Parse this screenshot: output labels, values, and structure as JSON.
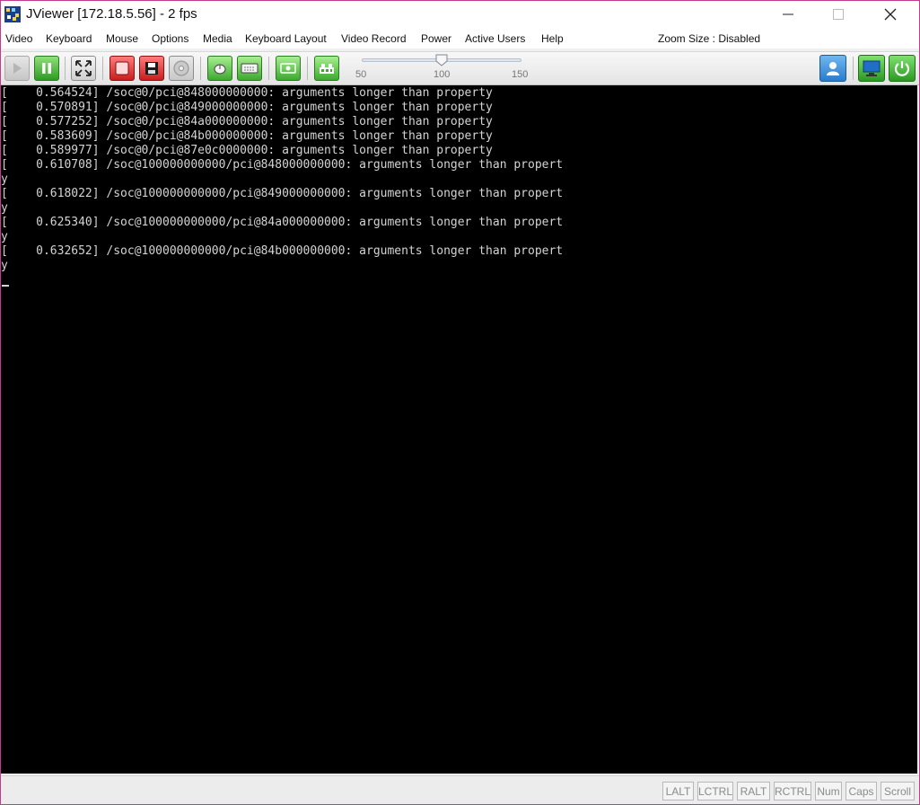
{
  "window": {
    "title": "JViewer [172.18.5.56] - 2 fps"
  },
  "menu": {
    "items": [
      "Video",
      "Keyboard",
      "Mouse",
      "Options",
      "Media",
      "Keyboard Layout",
      "Video Record",
      "Power",
      "Active Users",
      "Help"
    ],
    "zoom_label": "Zoom Size : Disabled"
  },
  "toolbar": {
    "buttons": [
      {
        "name": "play-button",
        "icon": "play-icon"
      },
      {
        "name": "pause-button",
        "icon": "pause-icon"
      },
      {
        "name": "fullscreen-button",
        "icon": "expand-icon"
      },
      {
        "name": "power-off-video-button",
        "icon": "red-screen-icon"
      },
      {
        "name": "floppy-button",
        "icon": "floppy-icon"
      },
      {
        "name": "cdrom-button",
        "icon": "cd-icon"
      },
      {
        "name": "mouse-button",
        "icon": "mouse-icon"
      },
      {
        "name": "keyboard-button",
        "icon": "keyboard-icon"
      },
      {
        "name": "video-record-button",
        "icon": "video-record-icon"
      },
      {
        "name": "soft-keyboard-button",
        "icon": "hardware-icon"
      }
    ],
    "zoom": {
      "min": "50",
      "mid": "100",
      "max": "150",
      "value": 100
    },
    "right_buttons": [
      {
        "name": "active-users-button",
        "icon": "user-icon"
      },
      {
        "name": "host-display-button",
        "icon": "monitor-icon"
      },
      {
        "name": "power-button",
        "icon": "power-icon"
      }
    ]
  },
  "console": {
    "lines": [
      "[    0.564524] /soc@0/pci@848000000000: arguments longer than property",
      "[    0.570891] /soc@0/pci@849000000000: arguments longer than property",
      "[    0.577252] /soc@0/pci@84a000000000: arguments longer than property",
      "[    0.583609] /soc@0/pci@84b000000000: arguments longer than property",
      "[    0.589977] /soc@0/pci@87e0c0000000: arguments longer than property",
      "[    0.610708] /soc@100000000000/pci@848000000000: arguments longer than propert",
      "y",
      "[    0.618022] /soc@100000000000/pci@849000000000: arguments longer than propert",
      "y",
      "[    0.625340] /soc@100000000000/pci@84a000000000: arguments longer than propert",
      "y",
      "[    0.632652] /soc@100000000000/pci@84b000000000: arguments longer than propert",
      "y"
    ]
  },
  "status_keys": [
    "LALT",
    "LCTRL",
    "RALT",
    "RCTRL",
    "Num",
    "Caps",
    "Scroll"
  ],
  "colors": {
    "console_bg": "#000000",
    "console_fg": "#d4d4d4",
    "window_border": "#c23b8f"
  }
}
